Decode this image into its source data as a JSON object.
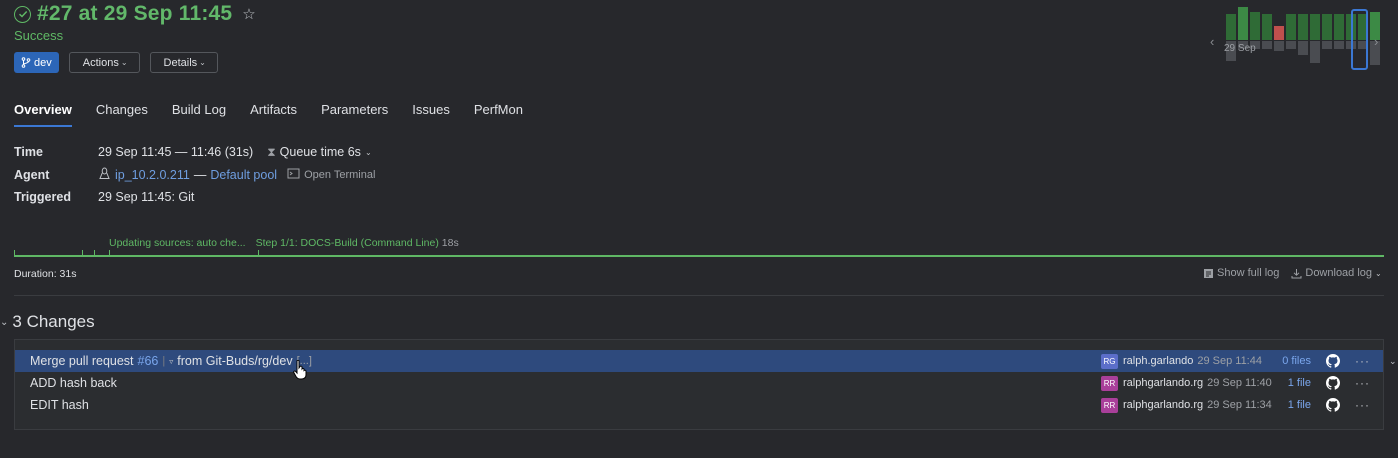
{
  "header": {
    "title": "#27 at 29 Sep 11:45",
    "status": "Success",
    "branch_label": "dev",
    "actions_label": "Actions",
    "details_label": "Details"
  },
  "history_chart": {
    "date_label": "29 Sep",
    "colors": {
      "success": "#2f6b36",
      "success_light": "#3c8a45",
      "failed": "#c0504d",
      "duration": "#4a4c51"
    }
  },
  "tabs": [
    "Overview",
    "Changes",
    "Build Log",
    "Artifacts",
    "Parameters",
    "Issues",
    "PerfMon"
  ],
  "info": {
    "time_label": "Time",
    "time_value": "29 Sep 11:45 — 11:46 (31s)",
    "queue_value": "Queue time 6s",
    "agent_label": "Agent",
    "agent_name": "ip_10.2.0.211",
    "agent_sep": "—",
    "agent_pool": "Default pool",
    "open_terminal": "Open Terminal",
    "triggered_label": "Triggered",
    "triggered_value": "29 Sep 11:45: Git"
  },
  "timeline": {
    "step1": "Updating sources: auto che...",
    "step2": "Step 1/1: DOCS-Build (Command Line)",
    "step2_duration": "18s"
  },
  "duration": "Duration: 31s",
  "log_links": {
    "show_full": "Show full log",
    "download": "Download log"
  },
  "changes": {
    "title": "3 Changes",
    "rows": [
      {
        "msg_prefix": "Merge pull request",
        "pr": "#66",
        "msg_suffix": "from Git-Buds/rg/dev",
        "ellipsis": "[...]",
        "initials": "RG",
        "author": "ralph.garlando",
        "time": "29 Sep 11:44",
        "files": "0 files",
        "avatar_color": "#5b6ec9"
      },
      {
        "msg": "ADD hash back",
        "initials": "RR",
        "author": "ralphgarlando.rg",
        "time": "29 Sep 11:40",
        "files": "1 file",
        "avatar_color": "#a93f9a"
      },
      {
        "msg": "EDIT hash",
        "initials": "RR",
        "author": "ralphgarlando.rg",
        "time": "29 Sep 11:34",
        "files": "1 file",
        "avatar_color": "#a93f9a"
      }
    ]
  }
}
